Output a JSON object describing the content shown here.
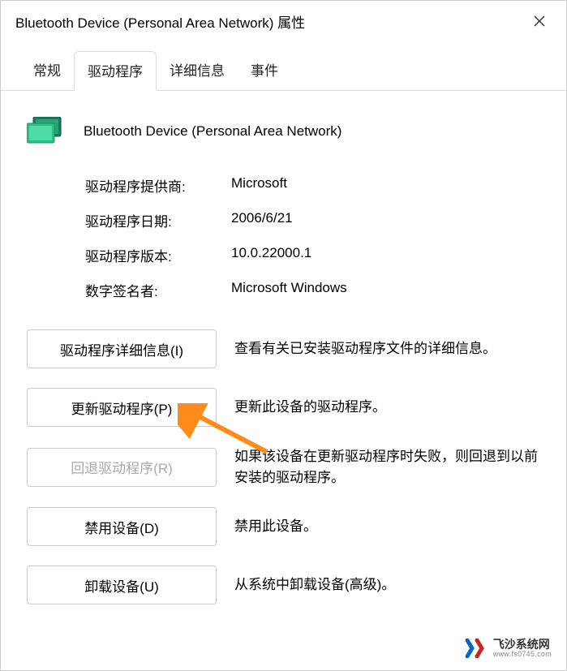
{
  "window": {
    "title": "Bluetooth Device (Personal Area Network) 属性"
  },
  "tabs": [
    {
      "label": "常规",
      "active": false
    },
    {
      "label": "驱动程序",
      "active": true
    },
    {
      "label": "详细信息",
      "active": false
    },
    {
      "label": "事件",
      "active": false
    }
  ],
  "device": {
    "name": "Bluetooth Device (Personal Area Network)"
  },
  "info": {
    "provider_label": "驱动程序提供商:",
    "provider_value": "Microsoft",
    "date_label": "驱动程序日期:",
    "date_value": "2006/6/21",
    "version_label": "驱动程序版本:",
    "version_value": "10.0.22000.1",
    "signer_label": "数字签名者:",
    "signer_value": "Microsoft Windows"
  },
  "actions": {
    "details_label": "驱动程序详细信息(I)",
    "details_desc": "查看有关已安装驱动程序文件的详细信息。",
    "update_label": "更新驱动程序(P)",
    "update_desc": "更新此设备的驱动程序。",
    "rollback_label": "回退驱动程序(R)",
    "rollback_desc": "如果该设备在更新驱动程序时失败，则回退到以前安装的驱动程序。",
    "disable_label": "禁用设备(D)",
    "disable_desc": "禁用此设备。",
    "uninstall_label": "卸载设备(U)",
    "uninstall_desc": "从系统中卸载设备(高级)。"
  },
  "watermark": {
    "main": "飞沙系统网",
    "sub": "www.fs0745.com"
  }
}
